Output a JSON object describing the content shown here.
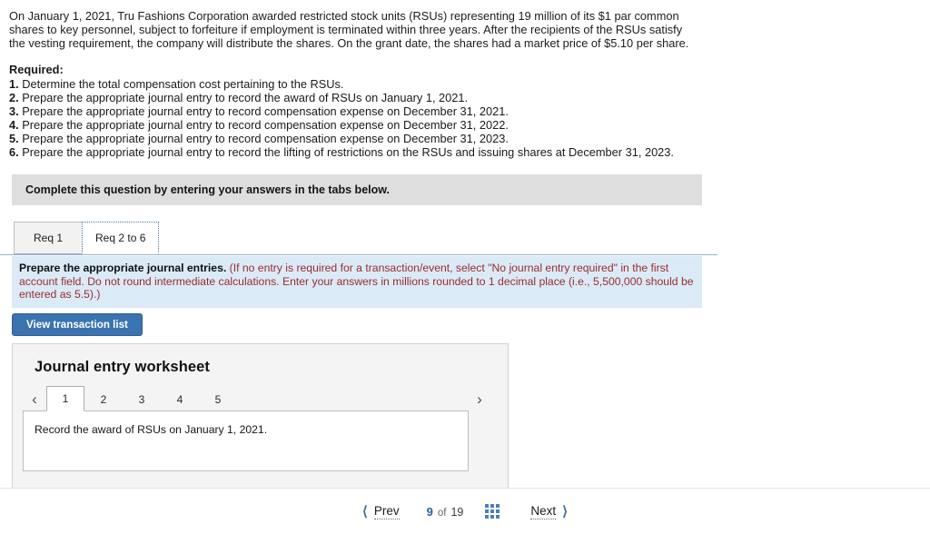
{
  "question": {
    "stem": "On January 1, 2021, Tru Fashions Corporation awarded restricted stock units (RSUs) representing 19 million of its $1 par common shares to key personnel, subject to forfeiture if employment is terminated within three years. After the recipients of the RSUs satisfy the vesting requirement, the company will distribute the shares. On the grant date, the shares had a market price of $5.10 per share.",
    "required_label": "Required:",
    "requirements": [
      {
        "num": "1.",
        "text": "Determine the total compensation cost pertaining to the RSUs."
      },
      {
        "num": "2.",
        "text": "Prepare the appropriate journal entry to record the award of RSUs on January 1, 2021."
      },
      {
        "num": "3.",
        "text": "Prepare the appropriate journal entry to record compensation expense on December 31, 2021."
      },
      {
        "num": "4.",
        "text": "Prepare the appropriate journal entry to record compensation expense on December 31, 2022."
      },
      {
        "num": "5.",
        "text": "Prepare the appropriate journal entry to record compensation expense on December 31, 2023."
      },
      {
        "num": "6.",
        "text": "Prepare the appropriate journal entry to record the lifting of restrictions on the RSUs and issuing shares at December 31, 2023."
      }
    ]
  },
  "complete_bar": {
    "text": "Complete this question by entering your answers in the tabs below."
  },
  "req_tabs": [
    {
      "label": "Req 1",
      "active": false
    },
    {
      "label": "Req 2 to 6",
      "active": true
    }
  ],
  "instruction_panel": {
    "bold_lead": "Prepare the appropriate journal entries.",
    "note": "(If no entry is required for a transaction/event, select \"No journal entry required\" in the first account field. Do not round intermediate calculations. Enter your answers in millions rounded to 1 decimal place (i.e., 5,500,000 should be entered as 5.5).)"
  },
  "buttons": {
    "view_transaction_list": "View transaction list"
  },
  "worksheet": {
    "title": "Journal entry worksheet",
    "prev_icon": "chevron-left",
    "next_icon": "chevron-right",
    "pages": [
      "1",
      "2",
      "3",
      "4",
      "5"
    ],
    "active_page": "1",
    "entry_prompt": "Record the award of RSUs on January 1, 2021."
  },
  "bottom_nav": {
    "prev_label": "Prev",
    "next_label": "Next",
    "page_current": "9",
    "page_of": "of",
    "page_total": "19",
    "grid_icon": "grid-icon",
    "accent_color": "#3a6fa8"
  }
}
